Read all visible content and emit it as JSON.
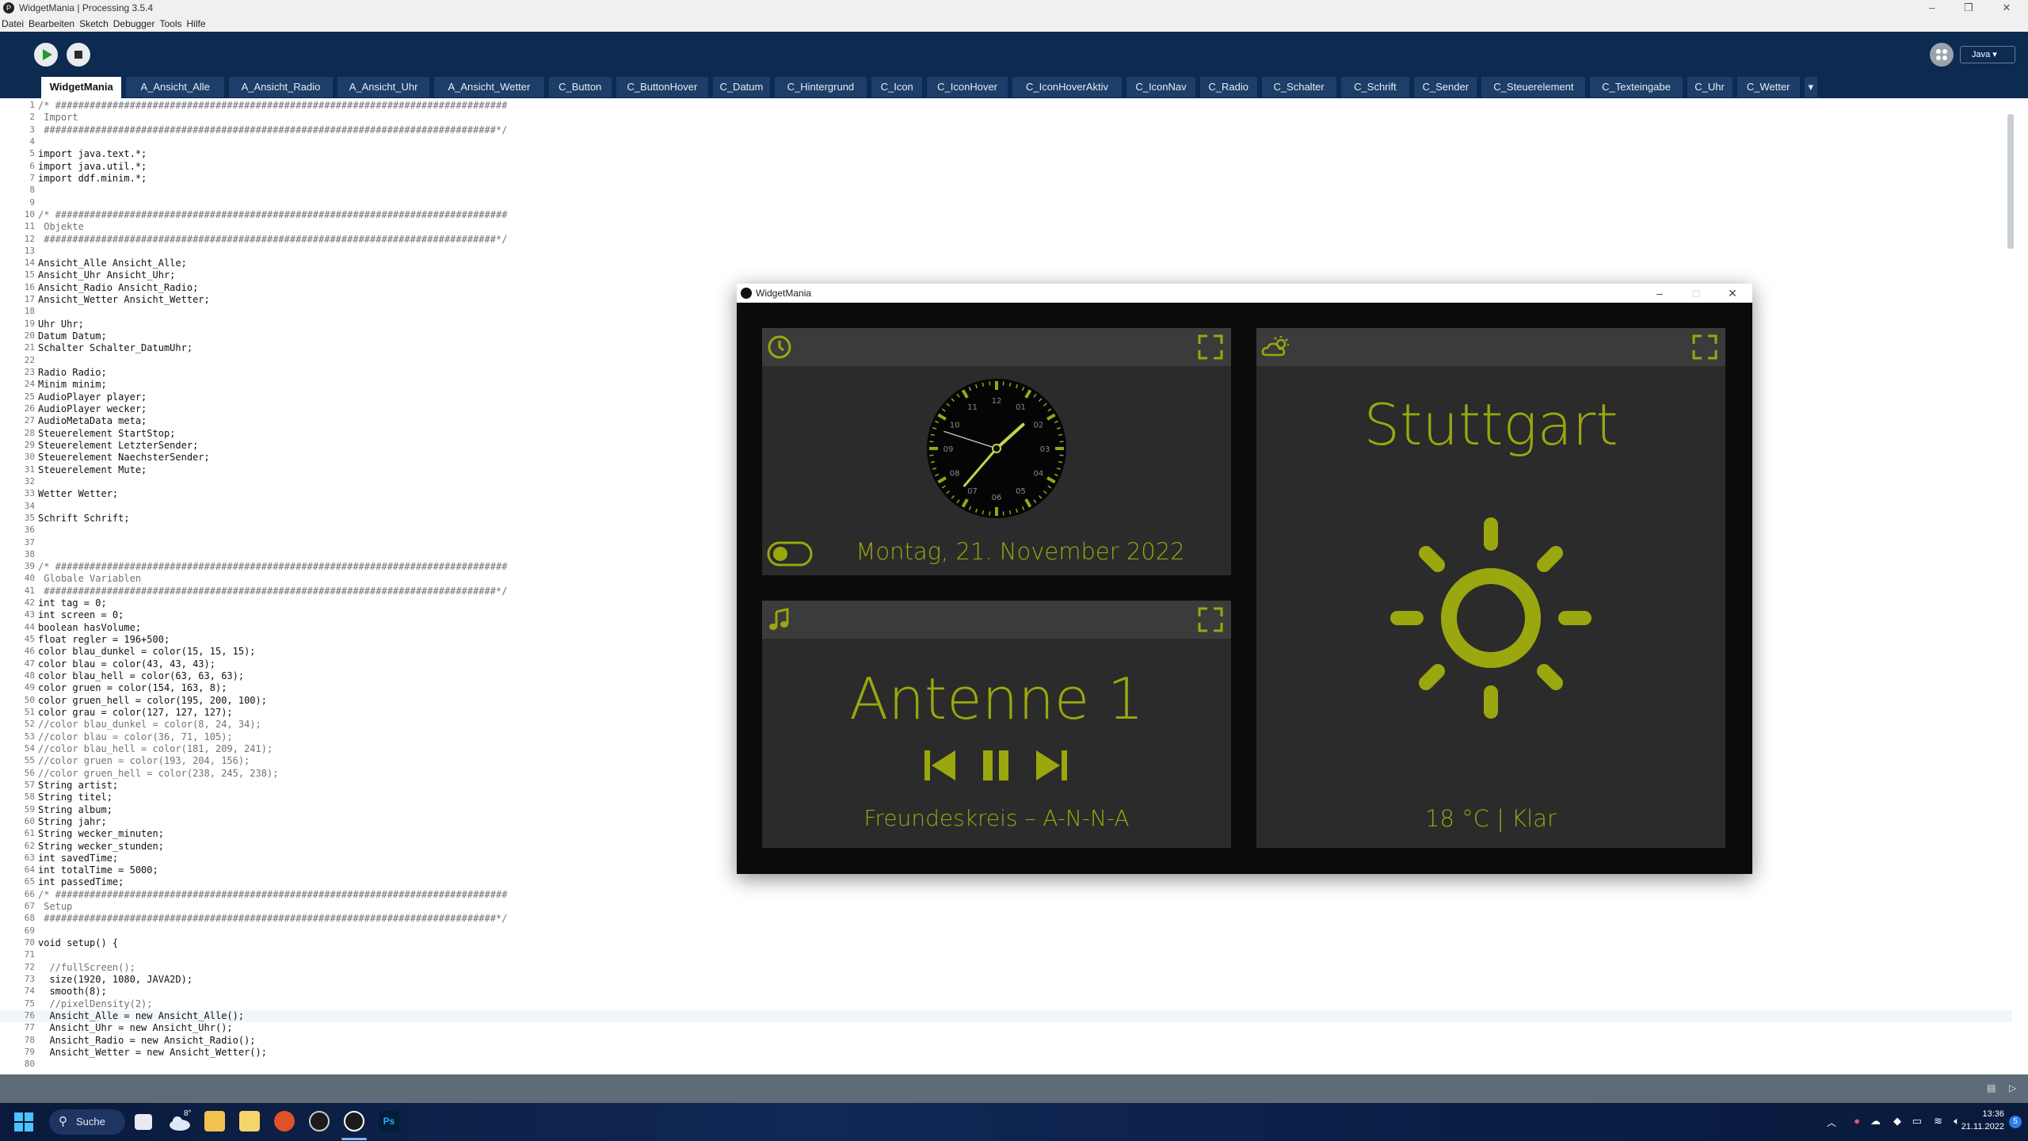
{
  "window": {
    "title": "WidgetMania | Processing 3.5.4",
    "menu": [
      "Datei",
      "Bearbeiten",
      "Sketch",
      "Debugger",
      "Tools",
      "Hilfe"
    ]
  },
  "toolbar": {
    "mode": "Java ▾"
  },
  "tabs": [
    "WidgetMania",
    "A_Ansicht_Alle",
    "A_Ansicht_Radio",
    "A_Ansicht_Uhr",
    "A_Ansicht_Wetter",
    "C_Button",
    "C_ButtonHover",
    "C_Datum",
    "C_Hintergrund",
    "C_Icon",
    "C_IconHover",
    "C_IconHoverAktiv",
    "C_IconNav",
    "C_Radio",
    "C_Schalter",
    "C_Schrift",
    "C_Sender",
    "C_Steuerelement",
    "C_Texteingabe",
    "C_Uhr",
    "C_Wetter"
  ],
  "code": [
    "/* ###############################################################################",
    " Import",
    " ###############################################################################*/",
    "",
    "import java.text.*;",
    "import java.util.*;",
    "import ddf.minim.*;",
    "",
    "",
    "/* ###############################################################################",
    " Objekte",
    " ###############################################################################*/",
    "",
    "Ansicht_Alle Ansicht_Alle;",
    "Ansicht_Uhr Ansicht_Uhr;",
    "Ansicht_Radio Ansicht_Radio;",
    "Ansicht_Wetter Ansicht_Wetter;",
    "",
    "Uhr Uhr;",
    "Datum Datum;",
    "Schalter Schalter_DatumUhr;",
    "",
    "Radio Radio;",
    "Minim minim;",
    "AudioPlayer player;",
    "AudioPlayer wecker;",
    "AudioMetaData meta;",
    "Steuerelement StartStop;",
    "Steuerelement LetzterSender;",
    "Steuerelement NaechsterSender;",
    "Steuerelement Mute;",
    "",
    "Wetter Wetter;",
    "",
    "Schrift Schrift;",
    "",
    "",
    "",
    "/* ###############################################################################",
    " Globale Variablen",
    " ###############################################################################*/",
    "int tag = 0;",
    "int screen = 0;",
    "boolean hasVolume;",
    "float regler = 196+500;",
    "color blau_dunkel = color(15, 15, 15);",
    "color blau = color(43, 43, 43);",
    "color blau_hell = color(63, 63, 63);",
    "color gruen = color(154, 163, 8);",
    "color gruen_hell = color(195, 200, 100);",
    "color grau = color(127, 127, 127);",
    "//color blau_dunkel = color(8, 24, 34);",
    "//color blau = color(36, 71, 105);",
    "//color blau_hell = color(181, 209, 241);",
    "//color gruen = color(193, 204, 156);",
    "//color gruen_hell = color(238, 245, 238);",
    "String artist;",
    "String titel;",
    "String album;",
    "String jahr;",
    "String wecker_minuten;",
    "String wecker_stunden;",
    "int savedTime;",
    "int totalTime = 5000;",
    "int passedTime;",
    "/* ###############################################################################",
    " Setup",
    " ###############################################################################*/",
    "",
    "void setup() {",
    "",
    "  //fullScreen();",
    "  size(1920, 1080, JAVA2D);",
    "  smooth(8);",
    "  //pixelDensity(2);",
    "  Ansicht_Alle = new Ansicht_Alle();",
    "  Ansicht_Uhr = new Ansicht_Uhr();",
    "  Ansicht_Radio = new Ansicht_Radio();",
    "  Ansicht_Wetter = new Ansicht_Wetter();",
    ""
  ],
  "widget": {
    "title": "WidgetMania",
    "date": "Montag, 21. November 2022",
    "clock": {
      "hour": 1,
      "minute": 36,
      "second": 48,
      "labels": [
        "12",
        "01",
        "02",
        "03",
        "04",
        "05",
        "06",
        "07",
        "08",
        "09",
        "10",
        "11"
      ]
    },
    "station": "Antenne 1",
    "song": "Freundeskreis – A-N-N-A",
    "city": "Stuttgart",
    "weather": "18 °C | Klar"
  },
  "taskbar": {
    "search": "Suche",
    "weather_badge": "8°",
    "time": "13:36",
    "date": "21.11.2022",
    "notif": "5"
  },
  "colors": {
    "accent": "#9aa70e",
    "panel": "#2b2b2b",
    "panel_head": "#3b3b3b",
    "ide_blue": "#0d2a50"
  }
}
